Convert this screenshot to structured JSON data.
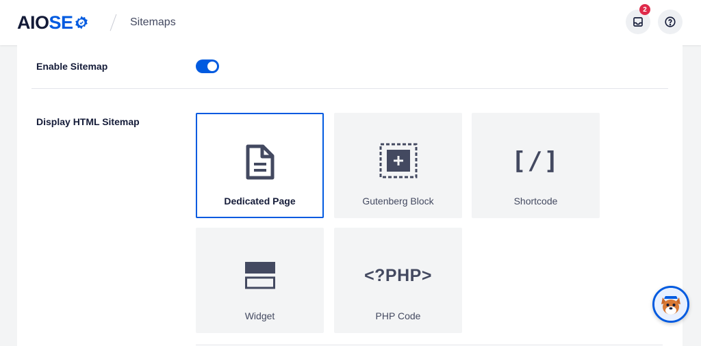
{
  "header": {
    "logo_part1": "AIO",
    "logo_part2": "SE",
    "breadcrumb": "Sitemaps",
    "notification_count": "2",
    "inbox_icon": "inbox-icon",
    "help_icon": "help-circle-icon"
  },
  "settings": {
    "enable_sitemap": {
      "label": "Enable Sitemap",
      "enabled": true
    },
    "display_html_sitemap": {
      "label": "Display HTML Sitemap",
      "selected": "Dedicated Page",
      "options": [
        {
          "label": "Dedicated Page",
          "icon": "document-icon"
        },
        {
          "label": "Gutenberg Block",
          "icon": "block-plus-icon"
        },
        {
          "label": "Shortcode",
          "icon": "shortcode-icon",
          "glyph": "[/]"
        },
        {
          "label": "Widget",
          "icon": "widget-icon"
        },
        {
          "label": "PHP Code",
          "icon": "php-icon",
          "glyph": "<?PHP>"
        }
      ]
    }
  },
  "colors": {
    "accent": "#005ae0",
    "badge": "#df2a4a",
    "text_dark": "#141b38",
    "text_muted": "#434960"
  },
  "assistant": {
    "icon": "mascot-avatar-icon"
  }
}
